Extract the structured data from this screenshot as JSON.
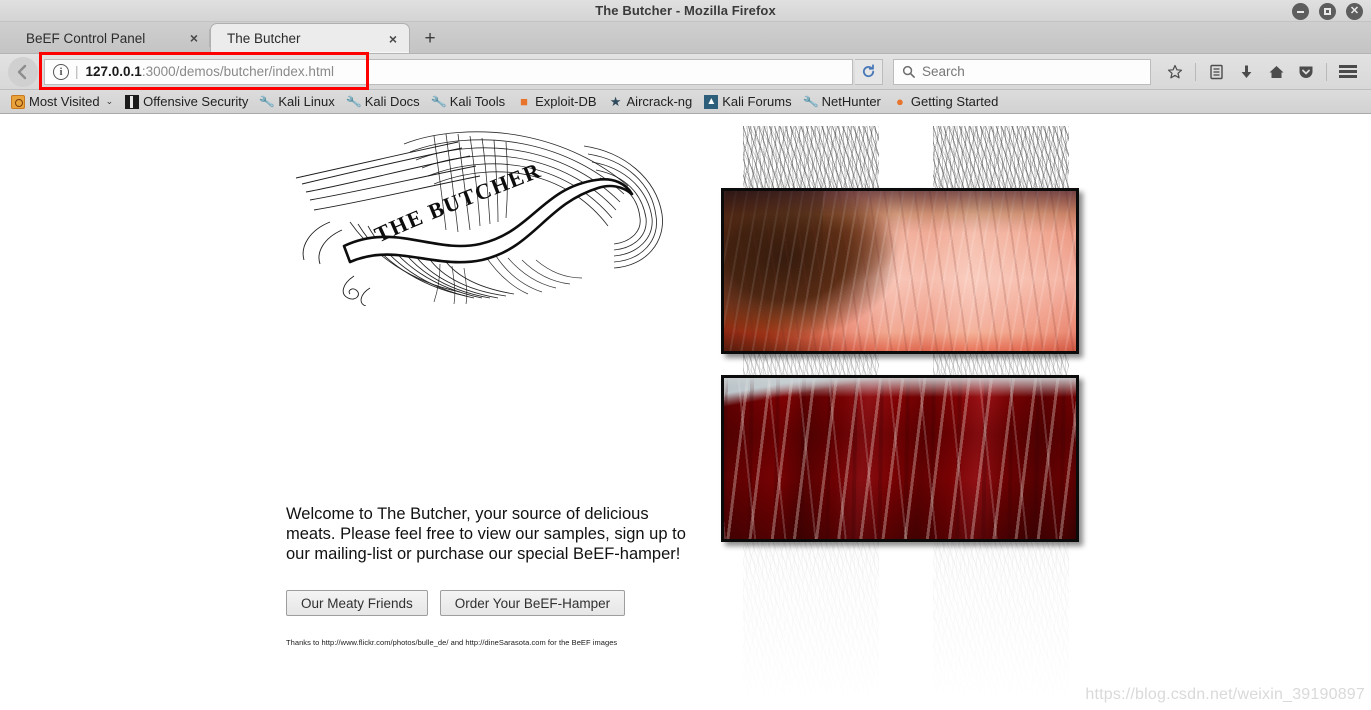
{
  "window": {
    "title": "The Butcher - Mozilla Firefox",
    "controls": {
      "minimize": "minimize-button",
      "maximize": "maximize-button",
      "close": "close-button"
    }
  },
  "tabs": [
    {
      "label": "BeEF Control Panel",
      "close": "×",
      "active": false
    },
    {
      "label": "The Butcher",
      "close": "×",
      "active": true
    }
  ],
  "newtab_label": "+",
  "navbar": {
    "back_glyph": "←",
    "identity_glyph": "i",
    "url_separator": "|",
    "url_host": "127.0.0.1",
    "url_rest": ":3000/demos/butcher/index.html",
    "url_full": "127.0.0.1:3000/demos/butcher/index.html",
    "highlight_color": "#ff0000",
    "reload_glyph": "⟳",
    "search_placeholder": "Search",
    "search_value": "",
    "search_icon_glyph": "⌕",
    "icons": [
      {
        "name": "bookmark-star-icon",
        "glyph": "☆"
      },
      {
        "name": "reader-list-icon",
        "glyph": "▤"
      },
      {
        "name": "downloads-icon",
        "glyph": "⬇"
      },
      {
        "name": "home-icon",
        "glyph": "⌂"
      },
      {
        "name": "pocket-icon",
        "glyph": "⬥"
      }
    ]
  },
  "bookmarks": [
    {
      "label": "Most Visited",
      "icon": "most-visited-icon",
      "chevron": "⌄"
    },
    {
      "label": "Offensive Security",
      "icon": "offensive-security-icon",
      "chevron": ""
    },
    {
      "label": "Kali Linux",
      "icon": "kali-wrench-icon",
      "chevron": ""
    },
    {
      "label": "Kali Docs",
      "icon": "kali-wrench-icon",
      "chevron": ""
    },
    {
      "label": "Kali Tools",
      "icon": "kali-wrench-icon",
      "chevron": ""
    },
    {
      "label": "Exploit-DB",
      "icon": "exploit-db-icon",
      "chevron": ""
    },
    {
      "label": "Aircrack-ng",
      "icon": "aircrack-ng-icon",
      "chevron": ""
    },
    {
      "label": "Kali Forums",
      "icon": "kali-forums-icon",
      "chevron": ""
    },
    {
      "label": "NetHunter",
      "icon": "kali-wrench-icon",
      "chevron": ""
    },
    {
      "label": "Getting Started",
      "icon": "firefox-icon",
      "chevron": ""
    }
  ],
  "page": {
    "logo_banner_text": "THE BUTCHER",
    "intro_paragraph": "Welcome to The Butcher, your source of delicious meats. Please feel free to view our samples, sign up to our mailing-list or purchase our special BeEF-hamper!",
    "buttons": [
      {
        "label": "Our Meaty Friends",
        "name": "our-meaty-friends-button"
      },
      {
        "label": "Order Your BeEF-Hamper",
        "name": "order-beef-hamper-button"
      }
    ],
    "credit_text": "Thanks to http://www.flickr.com/photos/bulle_de/ and http://dineSarasota.com for the BeEF images",
    "photos": [
      {
        "name": "roast-beef-photo",
        "alt": "Sliced roast beef close-up"
      },
      {
        "name": "raw-red-meat-photo",
        "alt": "Raw red meat cuts close-up"
      }
    ],
    "watermark": "https://blog.csdn.net/weixin_39190897"
  }
}
